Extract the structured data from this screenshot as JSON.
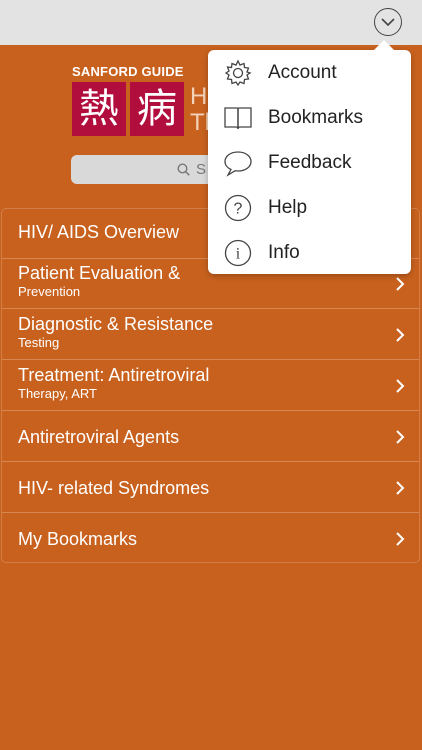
{
  "header": {
    "menu_toggle_icon": "chevron-down-icon"
  },
  "brand": {
    "guide_label": "SANFORD GUIDE",
    "kanji_1": "熱",
    "kanji_2": "病",
    "title_line1": "HI",
    "title_line2": "Th"
  },
  "search": {
    "placeholder": "S",
    "icon": "search-icon"
  },
  "menu": {
    "items": [
      {
        "label": "HIV/ AIDS Overview",
        "sub": ""
      },
      {
        "label": "Patient Evaluation &",
        "sub": "Prevention"
      },
      {
        "label": "Diagnostic & Resistance",
        "sub": "Testing"
      },
      {
        "label": "Treatment: Antiretroviral",
        "sub": "Therapy,  ART"
      },
      {
        "label": "Antiretroviral Agents",
        "sub": ""
      },
      {
        "label": "HIV- related Syndromes",
        "sub": ""
      },
      {
        "label": "My Bookmarks",
        "sub": ""
      }
    ]
  },
  "popup": {
    "items": [
      {
        "label": "Account",
        "icon": "gear-icon"
      },
      {
        "label": "Bookmarks",
        "icon": "book-icon"
      },
      {
        "label": "Feedback",
        "icon": "speech-bubble-icon"
      },
      {
        "label": "Help",
        "icon": "question-icon"
      },
      {
        "label": "Info",
        "icon": "info-icon"
      }
    ]
  },
  "colors": {
    "background": "#C8611E",
    "topbar": "#E3E3E3",
    "brand_kanji": "#B10E3E"
  }
}
